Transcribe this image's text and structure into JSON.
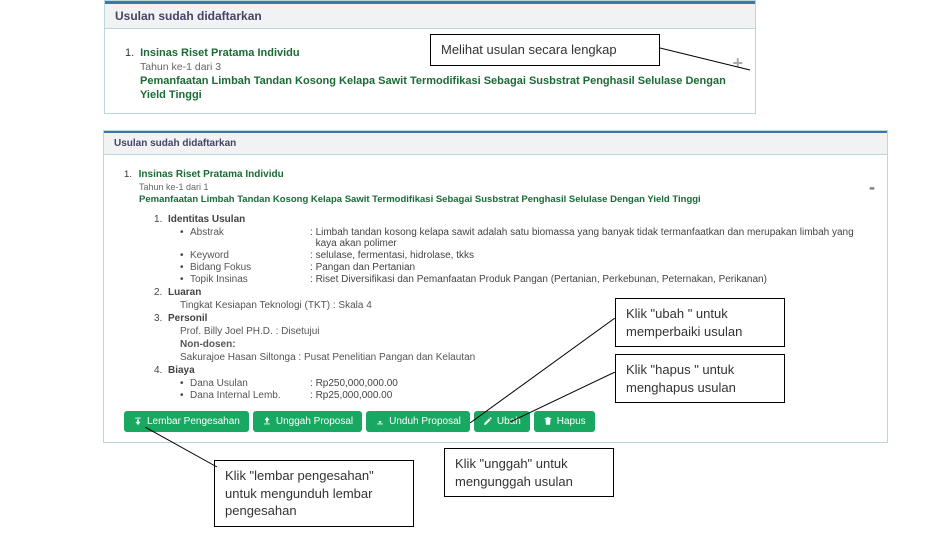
{
  "panel1": {
    "header": "Usulan sudah didaftarkan",
    "item_no": "1.",
    "scheme": "Insinas Riset Pratama Individu",
    "year": "Tahun ke-1 dari 3",
    "title": "Pemanfaatan Limbah Tandan Kosong Kelapa Sawit Termodifikasi Sebagai Susbstrat Penghasil Selulase Dengan Yield Tinggi",
    "plus": "+"
  },
  "panel2": {
    "header": "Usulan sudah didaftarkan",
    "item_no": "1.",
    "scheme": "Insinas Riset Pratama Individu",
    "year": "Tahun ke-1 dari 1",
    "title": "Pemanfaatan Limbah Tandan Kosong Kelapa Sawit Termodifikasi Sebagai Susbstrat Penghasil Selulase Dengan Yield Tinggi",
    "minus": "-",
    "sections": {
      "s1": "Identitas Usulan",
      "abstrak_k": "Abstrak",
      "abstrak_v": "Limbah tandan kosong kelapa sawit adalah satu biomassa yang banyak tidak termanfaatkan dan merupakan limbah yang kaya akan polimer",
      "keyword_k": "Keyword",
      "keyword_v": "selulase, fermentasi, hidrolase, tkks",
      "bidang_k": "Bidang Fokus",
      "bidang_v": "Pangan dan Pertanian",
      "topik_k": "Topik Insinas",
      "topik_v": "Riset Diversifikasi dan Pemanfaatan Produk Pangan (Pertanian, Perkebunan, Peternakan, Perikanan)",
      "s2": "Luaran",
      "tkt": "Tingkat Kesiapan Teknologi (TKT) : Skala 4",
      "s3": "Personil",
      "personil1": "Prof. Billy Joel PH.D. : Disetujui",
      "non": "Non-dosen:",
      "personil2": "Sakurajoe Hasan Siltonga : Pusat Penelitian Pangan dan Kelautan",
      "s4": "Biaya",
      "dana1_k": "Dana Usulan",
      "dana1_v": "Rp250,000,000.00",
      "dana2_k": "Dana Internal Lemb.",
      "dana2_v": "Rp25,000,000.00"
    },
    "buttons": {
      "b1": "Lembar Pengesahan",
      "b2": "Unggah Proposal",
      "b3": "Unduh Proposal",
      "b4": "Ubah",
      "b5": "Hapus"
    }
  },
  "annotations": {
    "a1": "Melihat usulan secara lengkap",
    "a2": "Klik \"ubah \" untuk memperbaiki usulan",
    "a3": "Klik \"hapus \" untuk menghapus usulan",
    "a4": "Klik \"lembar pengesahan\" untuk mengunduh lembar pengesahan",
    "a5": "Klik \"unggah\" untuk mengunggah usulan"
  }
}
